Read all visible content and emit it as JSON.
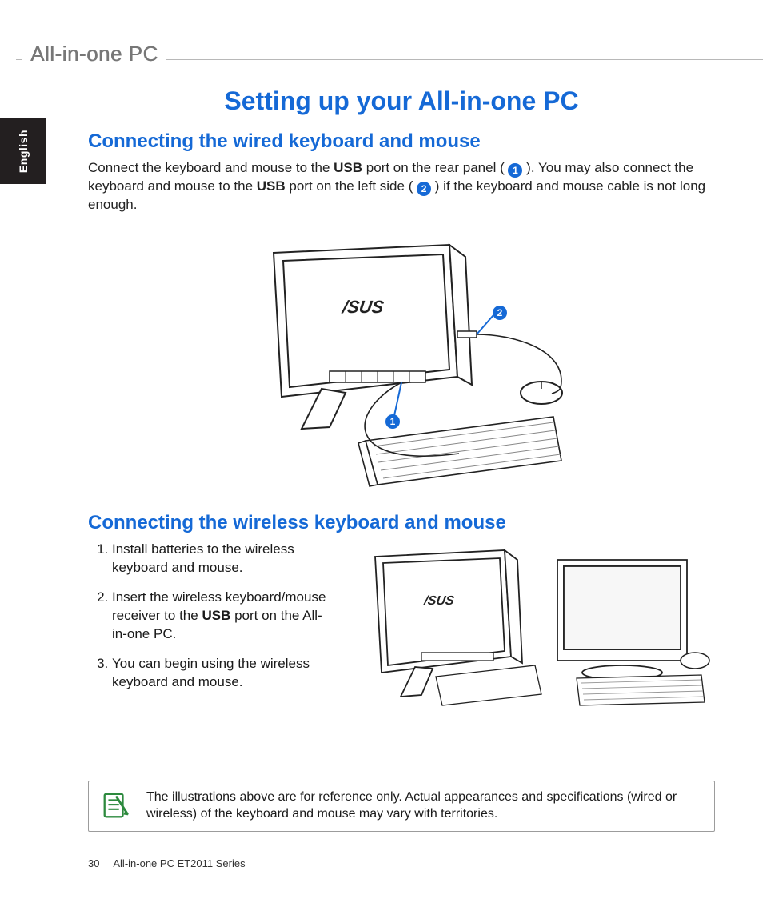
{
  "header": {
    "product": "All-in-one PC"
  },
  "lang_tab": "English",
  "title": "Setting up your All-in-one PC",
  "section1": {
    "heading": "Connecting the wired keyboard and mouse",
    "p_a": "Connect the keyboard and mouse to the ",
    "usb1": "USB",
    "p_b": " port on the rear panel ( ",
    "c1": "1",
    "p_c": " ). You may also connect the keyboard and mouse to the ",
    "usb2": "USB",
    "p_d": " port on the left side ( ",
    "c2": "2",
    "p_e": " ) if the keyboard and mouse cable is not long enough.",
    "callout1": "1",
    "callout2": "2"
  },
  "section2": {
    "heading": "Connecting the wireless keyboard and mouse",
    "steps": {
      "s1": "Install batteries to the wireless keyboard and mouse.",
      "s2a": "Insert the wireless keyboard/mouse receiver to the ",
      "s2usb": "USB",
      "s2b": " port on the All-in-one PC.",
      "s3": "You can begin using the wireless keyboard and mouse."
    }
  },
  "note": "The illustrations above are for reference only. Actual appearances and specifications (wired or wireless) of the keyboard and mouse may vary with territories.",
  "footer": {
    "page": "30",
    "series": "All-in-one PC ET2011 Series"
  }
}
